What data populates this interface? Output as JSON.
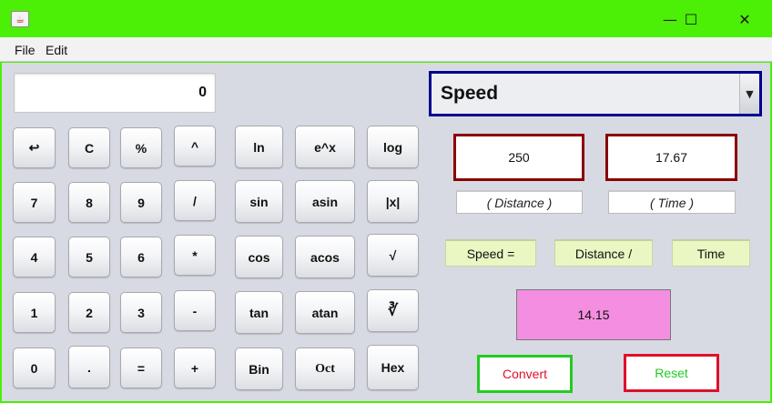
{
  "window": {
    "app_icon": "java-coffee-icon",
    "minimize_symbol": "—",
    "maximize_symbol": "☐",
    "close_symbol": "✕"
  },
  "menu": {
    "file": "File",
    "edit": "Edit"
  },
  "display": {
    "value": "0"
  },
  "keypad": {
    "r1": [
      "↩",
      "C",
      "%",
      "^"
    ],
    "r2": [
      "7",
      "8",
      "9",
      "/"
    ],
    "r3": [
      "4",
      "5",
      "6",
      "*"
    ],
    "r4": [
      "1",
      "2",
      "3",
      "-"
    ],
    "r5": [
      "0",
      ".",
      "=",
      "+"
    ]
  },
  "functions": {
    "r1": [
      "ln",
      "e^x",
      "log"
    ],
    "r2": [
      "sin",
      "asin",
      "|x|"
    ],
    "r3": [
      "cos",
      "acos",
      "√"
    ],
    "r4": [
      "tan",
      "atan",
      "∛"
    ],
    "r5": [
      "Bin",
      "Oct",
      "Hex"
    ]
  },
  "converter": {
    "selected": "Speed",
    "arrow": "▼",
    "distance_value": "250",
    "time_value": "17.67",
    "distance_label": "( Distance )",
    "time_label": "( Time )",
    "formula": [
      "Speed  =",
      "Distance  /",
      "Time"
    ],
    "result": "14.15",
    "convert_label": "Convert",
    "reset_label": "Reset"
  },
  "colors": {
    "titlebar": "#4cef06",
    "combo_border": "#00008e",
    "field_border": "#8b0000",
    "result_bg": "#f38ee0",
    "convert_border": "#22cc22",
    "convert_text": "#e0102a",
    "reset_border": "#e0102a",
    "reset_text": "#22cc22"
  }
}
